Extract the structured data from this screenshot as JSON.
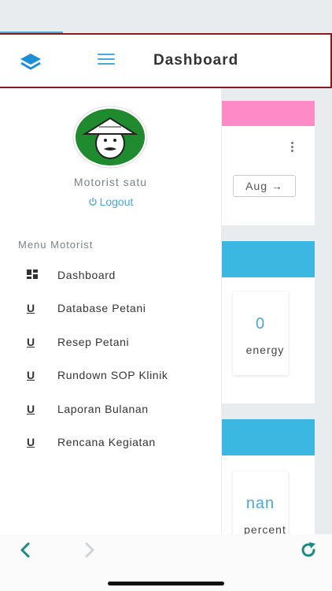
{
  "header": {
    "title": "Dashboard",
    "logo_icon": "layers-icon",
    "menu_icon": "hamburger-icon",
    "accent_color": "#4aa8e0",
    "border_color": "#8b1a1a"
  },
  "drawer": {
    "username": "Motorist satu",
    "logout_label": "Logout",
    "menu_header": "Menu Motorist",
    "items": [
      {
        "label": "Dashboard",
        "icon": "dashboard-grid-icon",
        "glyph": ""
      },
      {
        "label": "Database Petani",
        "icon": "u-icon",
        "glyph": "U"
      },
      {
        "label": "Resep Petani",
        "icon": "u-icon",
        "glyph": "U"
      },
      {
        "label": "Rundown SOP Klinik",
        "icon": "u-icon",
        "glyph": "U"
      },
      {
        "label": "Laporan Bulanan",
        "icon": "u-icon",
        "glyph": "U"
      },
      {
        "label": "Rencana Kegiatan",
        "icon": "u-icon",
        "glyph": "U"
      }
    ]
  },
  "background": {
    "card1": {
      "button_label": "Aug →",
      "band_color": "#ff8ac8"
    },
    "card2": {
      "value": "0",
      "label": "energy",
      "band_color": "#3bb7e2"
    },
    "card3": {
      "value": "nan",
      "label": "percent",
      "band_color": "#3bb7e2"
    }
  },
  "browser": {
    "back_icon": "chevron-left-icon",
    "forward_icon": "chevron-right-icon",
    "reload_icon": "reload-icon",
    "accent_color": "#1a8a86"
  }
}
